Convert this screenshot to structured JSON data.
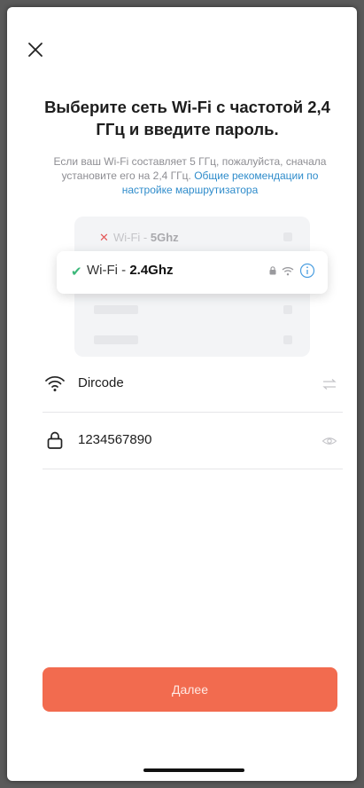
{
  "header": {
    "close_icon": "close-icon"
  },
  "title": "Выберите сеть Wi-Fi с частотой 2,4 ГГц и введите пароль.",
  "subtitle": {
    "text": "Если ваш Wi-Fi составляет 5 ГГц, пожалуйста, сначала установите его на 2,4 ГГц. ",
    "link": "Общие рекомендации по настройке маршрутизатора"
  },
  "illustration": {
    "row_5g": {
      "prefix": "Wi-Fi - ",
      "band": "5Ghz",
      "status_icon": "cross-icon"
    },
    "row_24g": {
      "prefix": "Wi-Fi - ",
      "band": "2.4Ghz",
      "status_icon": "check-icon"
    }
  },
  "form": {
    "ssid": {
      "value": "Dircode",
      "icon": "wifi-icon",
      "action_icon": "switch-icon"
    },
    "password": {
      "value": "1234567890",
      "icon": "lock-icon",
      "action_icon": "eye-icon"
    }
  },
  "next_button": {
    "label": "Далее"
  },
  "colors": {
    "accent": "#f26b4f",
    "link": "#2f8ccb",
    "success": "#3cb87a",
    "error": "#e45a5a"
  }
}
